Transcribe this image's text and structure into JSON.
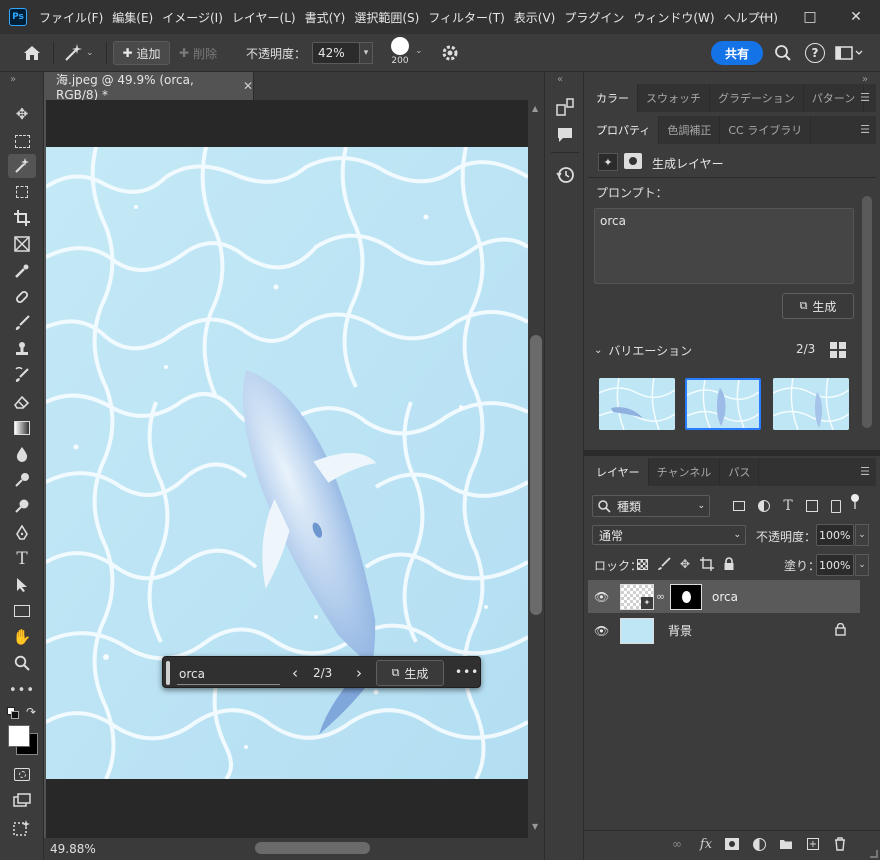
{
  "menubar": {
    "items": [
      "ファイル(F)",
      "編集(E)",
      "イメージ(I)",
      "レイヤー(L)",
      "書式(Y)",
      "選択範囲(S)",
      "フィルター(T)",
      "表示(V)",
      "プラグイン",
      "ウィンドウ(W)",
      "ヘルプ(H)"
    ],
    "app_logo": "Ps"
  },
  "options": {
    "add_label": "追加",
    "delete_label": "削除",
    "opacity_label": "不透明度：",
    "opacity_value": "42%",
    "brush_size": "200",
    "share_label": "共有"
  },
  "document": {
    "tab_title": "海.jpeg @ 49.9% (orca, RGB/8) *",
    "zoom_status": "49.88%"
  },
  "contextbar": {
    "prompt": "orca",
    "counter": "2/3",
    "generate_label": "生成"
  },
  "top_panel": {
    "tabs": [
      "カラー",
      "スウォッチ",
      "グラデーション",
      "パターン"
    ]
  },
  "properties": {
    "tabs": [
      "プロパティ",
      "色調補正",
      "CC ライブラリ"
    ],
    "layer_type": "生成レイヤー",
    "prompt_label": "プロンプト：",
    "prompt_value": "orca",
    "generate_label": "生成",
    "variations_label": "バリエーション",
    "variations_counter": "2/3"
  },
  "layers": {
    "tabs": [
      "レイヤー",
      "チャンネル",
      "パス"
    ],
    "filter_kind": "種類",
    "blend_mode": "通常",
    "opacity_label": "不透明度：",
    "opacity_value": "100%",
    "lock_label": "ロック：",
    "fill_label": "塗り：",
    "fill_value": "100%",
    "items": [
      {
        "name": "orca",
        "selected": true
      },
      {
        "name": "背景",
        "locked": true
      }
    ]
  },
  "colors": {
    "accent": "#1473e6",
    "water": "#bfe6f4",
    "panel_bg": "#3c3c3c"
  }
}
